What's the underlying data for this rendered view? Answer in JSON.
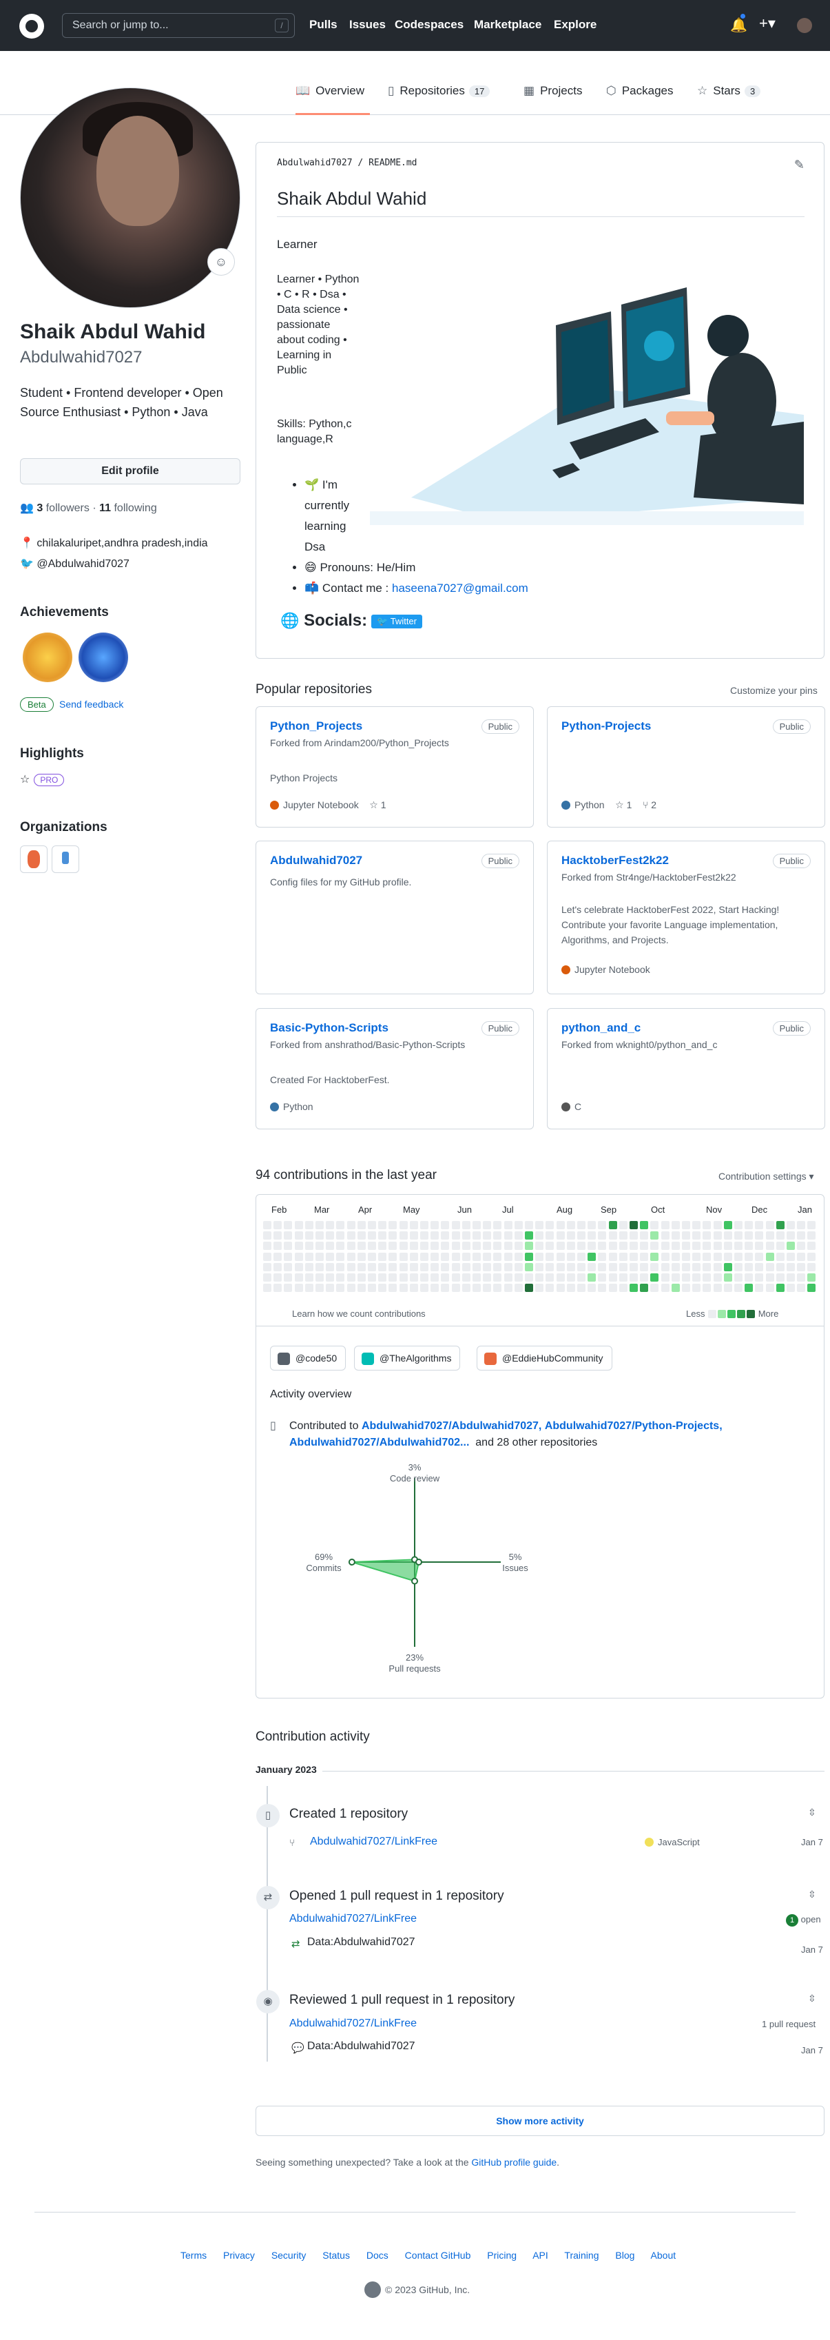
{
  "header": {
    "search_placeholder": "Search or jump to...",
    "search_key": "/",
    "nav": [
      "Pulls",
      "Issues",
      "Codespaces",
      "Marketplace",
      "Explore"
    ]
  },
  "tabs": [
    {
      "label": "Overview",
      "icon": "book-icon",
      "count": ""
    },
    {
      "label": "Repositories",
      "icon": "repo-icon",
      "count": "17"
    },
    {
      "label": "Projects",
      "icon": "table-icon",
      "count": ""
    },
    {
      "label": "Packages",
      "icon": "package-icon",
      "count": ""
    },
    {
      "label": "Stars",
      "icon": "star-icon",
      "count": "3"
    }
  ],
  "profile": {
    "name": "Shaik Abdul Wahid",
    "login": "Abdulwahid7027",
    "bio": "Student • Frontend developer • Open Source Enthusiast • Python • Java",
    "edit_label": "Edit profile",
    "followers_count": "3",
    "followers_label": "followers",
    "following_count": "11",
    "following_label": "following",
    "location": "chilakaluripet,andhra pradesh,india",
    "twitter": "@Abdulwahid7027",
    "achievements_title": "Achievements",
    "beta_label": "Beta",
    "feedback_label": "Send feedback",
    "highlights_title": "Highlights",
    "pro_label": "PRO",
    "organizations_title": "Organizations"
  },
  "readme": {
    "path_user": "Abdulwahid7027",
    "path_file": "README.md",
    "title": "Shaik Abdul Wahid",
    "learner": "Learner",
    "tagline": "Learner • Python • C • R • Dsa • Data science • passionate about coding • Learning in Public",
    "skills": "Skills: Python,c language,R",
    "list": [
      {
        "emoji": "🌱",
        "text": "I'm currently learning Dsa"
      },
      {
        "emoji": "😄",
        "text": "Pronouns: He/Him"
      },
      {
        "emoji": "📫",
        "text": "Contact me :",
        "link": "haseena7027@gmail.com"
      }
    ],
    "socials_label": "Socials:",
    "twitter_badge": "Twitter"
  },
  "popular": {
    "title": "Popular repositories",
    "customize": "Customize your pins",
    "repos": [
      {
        "name": "Python_Projects",
        "visibility": "Public",
        "fork": "Forked from Arindam200/Python_Projects",
        "desc": "Python Projects",
        "lang": "Jupyter Notebook",
        "lang_color": "#DA5B0B",
        "stars": "1",
        "forks": ""
      },
      {
        "name": "Python-Projects",
        "visibility": "Public",
        "fork": "",
        "desc": "",
        "lang": "Python",
        "lang_color": "#3572A5",
        "stars": "1",
        "forks": "2"
      },
      {
        "name": "Abdulwahid7027",
        "visibility": "Public",
        "fork": "",
        "desc": "Config files for my GitHub profile.",
        "lang": "",
        "lang_color": "",
        "stars": "",
        "forks": ""
      },
      {
        "name": "HacktoberFest2k22",
        "visibility": "Public",
        "fork": "Forked from Str4nge/HacktoberFest2k22",
        "desc": "Let's celebrate HacktoberFest 2022, Start Hacking! Contribute your favorite Language implementation, Algorithms, and Projects.",
        "lang": "Jupyter Notebook",
        "lang_color": "#DA5B0B",
        "stars": "",
        "forks": ""
      },
      {
        "name": "Basic-Python-Scripts",
        "visibility": "Public",
        "fork": "Forked from anshrathod/Basic-Python-Scripts",
        "desc": "Created For HacktoberFest.",
        "lang": "Python",
        "lang_color": "#3572A5",
        "stars": "",
        "forks": ""
      },
      {
        "name": "python_and_c",
        "visibility": "Public",
        "fork": "Forked from wknight0/python_and_c",
        "desc": "",
        "lang": "C",
        "lang_color": "#555555",
        "stars": "",
        "forks": ""
      }
    ]
  },
  "contributions": {
    "title": "94 contributions in the last year",
    "settings": "Contribution settings ▾",
    "months": [
      "Feb",
      "Mar",
      "Apr",
      "May",
      "Jun",
      "Jul",
      "Aug",
      "Sep",
      "Oct",
      "Nov",
      "Dec",
      "Jan"
    ],
    "learn": "Learn how we count contributions",
    "less": "Less",
    "more": "More",
    "colors": [
      "#ebedf0",
      "#9be9a8",
      "#40c463",
      "#30a14e",
      "#216e39"
    ]
  },
  "activity": {
    "orgs": [
      "@code50",
      "@TheAlgorithms",
      "@EddieHubCommunity"
    ],
    "overview_title": "Activity overview",
    "contributed_prefix": "Contributed to",
    "repo1": "Abdulwahid7027/Abdulwahid7027,",
    "repo2": "Abdulwahid7027/Python-Projects,",
    "repo3": "Abdulwahid7027/Abdulwahid702...",
    "others": "and 28 other repositories",
    "radar": {
      "code_review_pct": "3%",
      "code_review_label": "Code review",
      "commits_pct": "69%",
      "commits_label": "Commits",
      "issues_pct": "5%",
      "issues_label": "Issues",
      "pr_pct": "23%",
      "pr_label": "Pull requests",
      "values": {
        "code_review": 3,
        "commits": 69,
        "issues": 5,
        "pull_requests": 23
      }
    }
  },
  "contribution_activity": {
    "title": "Contribution activity",
    "month": "January 2023",
    "events": [
      {
        "heading": "Created 1 repository",
        "repo": "Abdulwahid7027/LinkFree",
        "lang": "JavaScript",
        "lang_color": "#f1e05a",
        "date": "Jan 7"
      },
      {
        "heading": "Opened 1 pull request in 1 repository",
        "repo": "Abdulwahid7027/LinkFree",
        "status": "open",
        "status_count": "1",
        "pr": "Data:Abdulwahid7027",
        "date": "Jan 7"
      },
      {
        "heading": "Reviewed 1 pull request in 1 repository",
        "repo": "Abdulwahid7027/LinkFree",
        "status": "1 pull request",
        "pr": "Data:Abdulwahid7027",
        "date": "Jan 7"
      }
    ],
    "show_more": "Show more activity",
    "unexpected_prefix": "Seeing something unexpected? Take a look at the",
    "unexpected_link": "GitHub profile guide",
    "unexpected_suffix": "."
  },
  "footer": {
    "links": [
      "Terms",
      "Privacy",
      "Security",
      "Status",
      "Docs",
      "Contact GitHub",
      "Pricing",
      "API",
      "Training",
      "Blog",
      "About"
    ],
    "copyright": "© 2023 GitHub, Inc."
  }
}
